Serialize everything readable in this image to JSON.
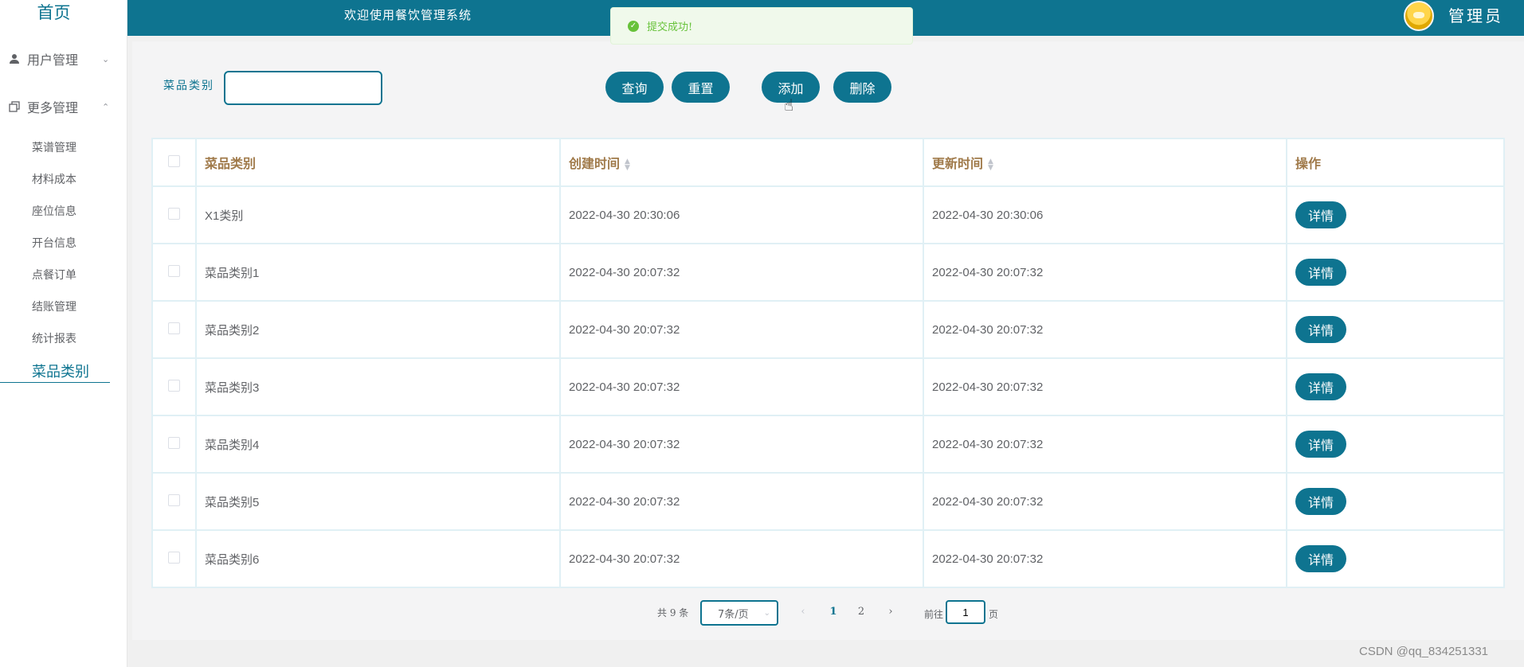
{
  "header": {
    "welcome": "欢迎使用餐饮管理系统",
    "admin_label": "管理员"
  },
  "sidebar": {
    "home_label": "首页",
    "groups": [
      {
        "icon": "user-icon",
        "label": "用户管理"
      },
      {
        "icon": "copy-icon",
        "label": "更多管理"
      }
    ],
    "items": [
      {
        "label": "菜谱管理"
      },
      {
        "label": "材料成本"
      },
      {
        "label": "座位信息"
      },
      {
        "label": "开台信息"
      },
      {
        "label": "点餐订单"
      },
      {
        "label": "结账管理"
      },
      {
        "label": "统计报表"
      },
      {
        "label": "菜品类别"
      }
    ],
    "active_item": "菜品类别"
  },
  "filter": {
    "label": "菜品类别",
    "value": "",
    "placeholder": ""
  },
  "toolbar": {
    "query": "查询",
    "reset": "重置",
    "add": "添加",
    "delete": "删除"
  },
  "table": {
    "headers": [
      "菜品类别",
      "创建时间",
      "更新时间",
      "操作"
    ],
    "rows": [
      {
        "category": "X1类别",
        "created": "2022-04-30 20:30:06",
        "updated": "2022-04-30 20:30:06",
        "action": "详情"
      },
      {
        "category": "菜品类别1",
        "created": "2022-04-30 20:07:32",
        "updated": "2022-04-30 20:07:32",
        "action": "详情"
      },
      {
        "category": "菜品类别2",
        "created": "2022-04-30 20:07:32",
        "updated": "2022-04-30 20:07:32",
        "action": "详情"
      },
      {
        "category": "菜品类别3",
        "created": "2022-04-30 20:07:32",
        "updated": "2022-04-30 20:07:32",
        "action": "详情"
      },
      {
        "category": "菜品类别4",
        "created": "2022-04-30 20:07:32",
        "updated": "2022-04-30 20:07:32",
        "action": "详情"
      },
      {
        "category": "菜品类别5",
        "created": "2022-04-30 20:07:32",
        "updated": "2022-04-30 20:07:32",
        "action": "详情"
      },
      {
        "category": "菜品类别6",
        "created": "2022-04-30 20:07:32",
        "updated": "2022-04-30 20:07:32",
        "action": "详情"
      }
    ]
  },
  "pagination": {
    "total": "共 9 条",
    "page_size": "7条/页",
    "pages": [
      "1",
      "2"
    ],
    "current_page": "1",
    "goto_label": "前往",
    "goto_value": "1",
    "page_suffix": "页"
  },
  "toast": {
    "message": "提交成功!",
    "type": "success"
  },
  "watermark": "CSDN @qq_834251331",
  "colors": {
    "primary": "#0e7490",
    "header_text": "#a07a4a",
    "success": "#67c23a"
  }
}
